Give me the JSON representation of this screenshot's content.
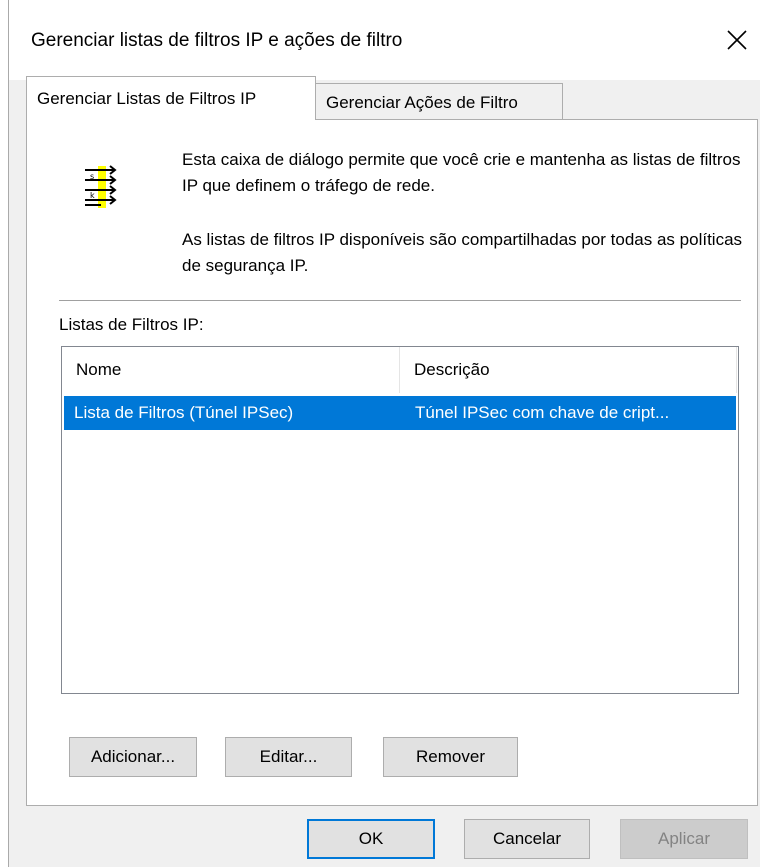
{
  "window": {
    "title": "Gerenciar listas de filtros IP e ações de filtro"
  },
  "tabs": [
    {
      "label": "Gerenciar Listas de Filtros IP",
      "active": true
    },
    {
      "label": "Gerenciar Ações de Filtro",
      "active": false
    }
  ],
  "info": {
    "icon": "filter-list-icon",
    "line1": "Esta caixa de diálogo permite que você crie e mantenha as listas de filtros IP que definem o tráfego de rede.",
    "line2": "As listas de filtros IP disponíveis são compartilhadas por todas as políticas de segurança IP."
  },
  "list": {
    "label": "Listas de Filtros IP:",
    "columns": [
      "Nome",
      "Descrição"
    ],
    "rows": [
      {
        "name": "Lista de Filtros (Túnel IPSec)",
        "description": "Túnel IPSec com chave de cript...",
        "selected": true
      }
    ]
  },
  "list_buttons": {
    "add": "Adicionar...",
    "edit": "Editar...",
    "remove": "Remover"
  },
  "dialog_buttons": {
    "ok": "OK",
    "cancel": "Cancelar",
    "apply": "Aplicar",
    "apply_enabled": false
  },
  "colors": {
    "selection": "#0078d7",
    "panel": "#f0f0f0"
  }
}
